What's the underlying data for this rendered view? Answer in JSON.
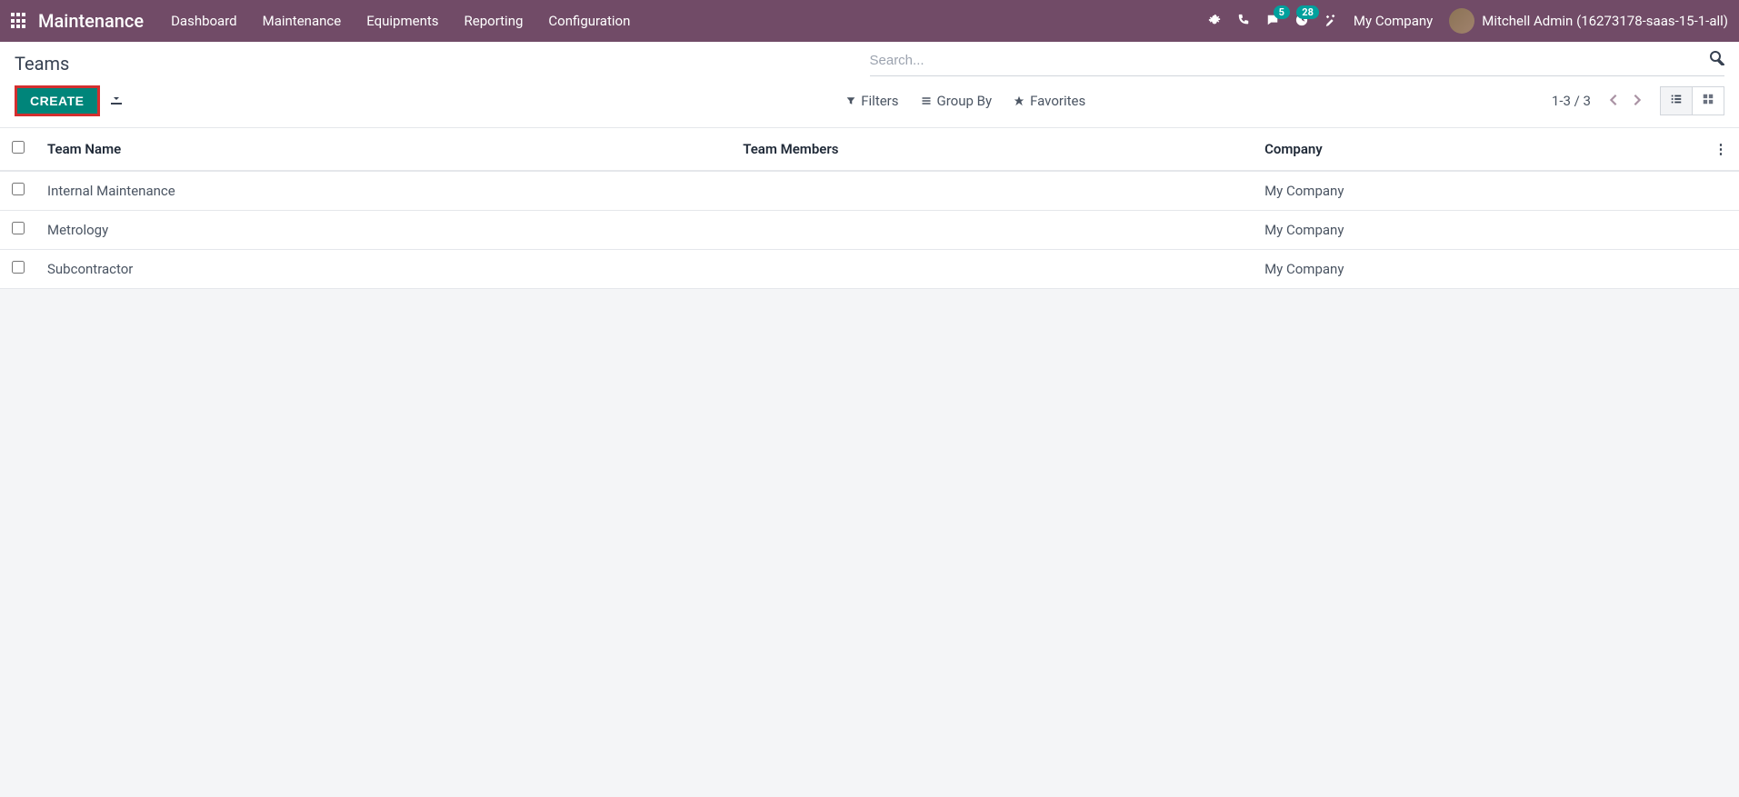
{
  "app_title": "Maintenance",
  "nav": {
    "items": [
      {
        "label": "Dashboard"
      },
      {
        "label": "Maintenance"
      },
      {
        "label": "Equipments"
      },
      {
        "label": "Reporting"
      },
      {
        "label": "Configuration"
      }
    ]
  },
  "systray": {
    "messages_count": "5",
    "activities_count": "28",
    "company": "My Company",
    "user": "Mitchell Admin (16273178-saas-15-1-all)"
  },
  "breadcrumb": "Teams",
  "search": {
    "placeholder": "Search..."
  },
  "buttons": {
    "create": "CREATE",
    "filters": "Filters",
    "group_by": "Group By",
    "favorites": "Favorites"
  },
  "pager": {
    "text": "1-3 / 3"
  },
  "table": {
    "headers": {
      "team_name": "Team Name",
      "team_members": "Team Members",
      "company": "Company"
    },
    "rows": [
      {
        "team_name": "Internal Maintenance",
        "team_members": "",
        "company": "My Company"
      },
      {
        "team_name": "Metrology",
        "team_members": "",
        "company": "My Company"
      },
      {
        "team_name": "Subcontractor",
        "team_members": "",
        "company": "My Company"
      }
    ]
  }
}
